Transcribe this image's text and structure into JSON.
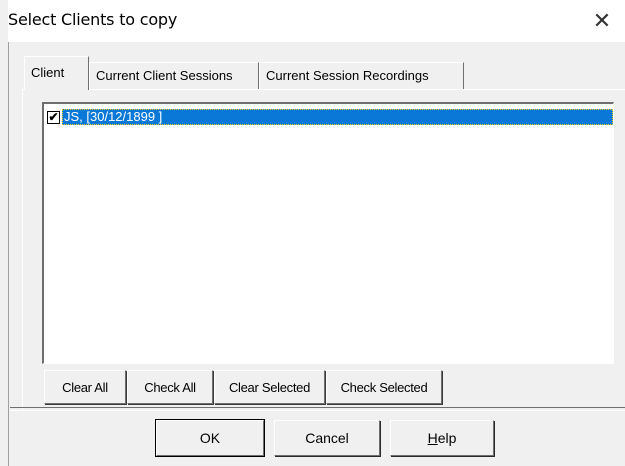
{
  "window": {
    "title": "Select Clients to copy",
    "close_glyph": "✕"
  },
  "tabs": [
    {
      "label": "Client",
      "active": true
    },
    {
      "label": "Current Client Sessions",
      "active": false
    },
    {
      "label": "Current Session Recordings",
      "active": false
    }
  ],
  "list": {
    "items": [
      {
        "label": "JS,  [30/12/1899  ]",
        "checked": true,
        "selected": true,
        "check_glyph": "✔"
      }
    ]
  },
  "actions": {
    "clear_all": "Clear All",
    "check_all": "Check All",
    "clear_selected": "Clear Selected",
    "check_selected": "Check Selected"
  },
  "dialog_buttons": {
    "ok": "OK",
    "cancel": "Cancel",
    "help_prefix": "",
    "help_underlined": "H",
    "help_rest": "elp"
  },
  "colors": {
    "selection": "#0a78d7",
    "face": "#f0f0f0"
  },
  "icons": [
    "close-icon",
    "checkbox-checked-icon"
  ]
}
